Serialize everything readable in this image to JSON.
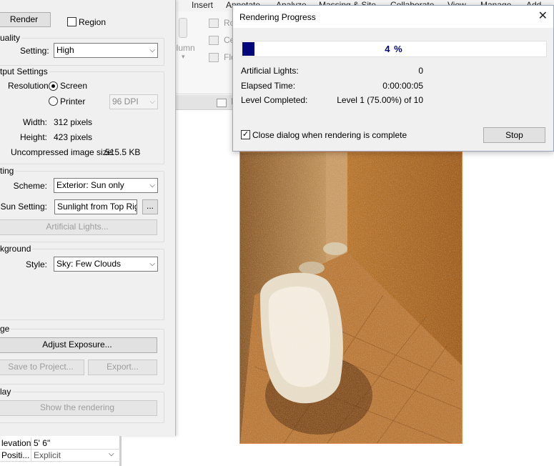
{
  "ribbon": {
    "tabs": [
      "Insert",
      "Annotate",
      "Analyze",
      "Massing & Site",
      "Collaborate",
      "View",
      "Manage",
      "Add-Ins"
    ],
    "column_label": "olumn",
    "items": [
      "Ro",
      "Ce",
      "Flo"
    ]
  },
  "render_dialog": {
    "render_button": "Render",
    "region_label": "Region",
    "region_checked": false,
    "quality": {
      "title": "uality",
      "setting_label": "Setting:",
      "setting_value": "High"
    },
    "output": {
      "title": "tput Settings",
      "resolution_label": "Resolution:",
      "screen_label": "Screen",
      "screen_selected": true,
      "printer_label": "Printer",
      "printer_selected": false,
      "dpi_value": "96 DPI",
      "width_label": "Width:",
      "width_value": "312 pixels",
      "height_label": "Height:",
      "height_value": "423 pixels",
      "size_label": "Uncompressed image size:",
      "size_value": "515.5 KB"
    },
    "lighting": {
      "title": "ting",
      "scheme_label": "Scheme:",
      "scheme_value": "Exterior: Sun only",
      "sun_label": "Sun Setting:",
      "sun_value": "Sunlight from Top Righ",
      "browse_label": "...",
      "artificial_button": "Artificial Lights..."
    },
    "background": {
      "title": "kground",
      "style_label": "Style:",
      "style_value": "Sky: Few Clouds"
    },
    "image": {
      "title": "ge",
      "adjust_button": "Adjust Exposure...",
      "save_button": "Save to Project...",
      "export_button": "Export..."
    },
    "display": {
      "title": "lay",
      "show_button": "Show the rendering"
    }
  },
  "properties": {
    "rows": [
      {
        "name": "levation",
        "value": "5'  6\""
      },
      {
        "name": "Positi...",
        "value": "Explicit"
      }
    ]
  },
  "progress_dialog": {
    "title": "Rendering Progress",
    "close_glyph": "✕",
    "percent": 4,
    "percent_label": "4 %",
    "artificial_label": "Artificial Lights:",
    "artificial_value": "0",
    "elapsed_label": "Elapsed Time:",
    "elapsed_value": "0:00:00:05",
    "level_label": "Level Completed:",
    "level_value": "Level 1 (75.00%) of 10",
    "close_when_done_label": "Close dialog when rendering is complete",
    "close_when_done_checked": true,
    "stop_button": "Stop"
  },
  "colors": {
    "progress_fill": "#02067a",
    "render_frame": "#e08a50"
  }
}
